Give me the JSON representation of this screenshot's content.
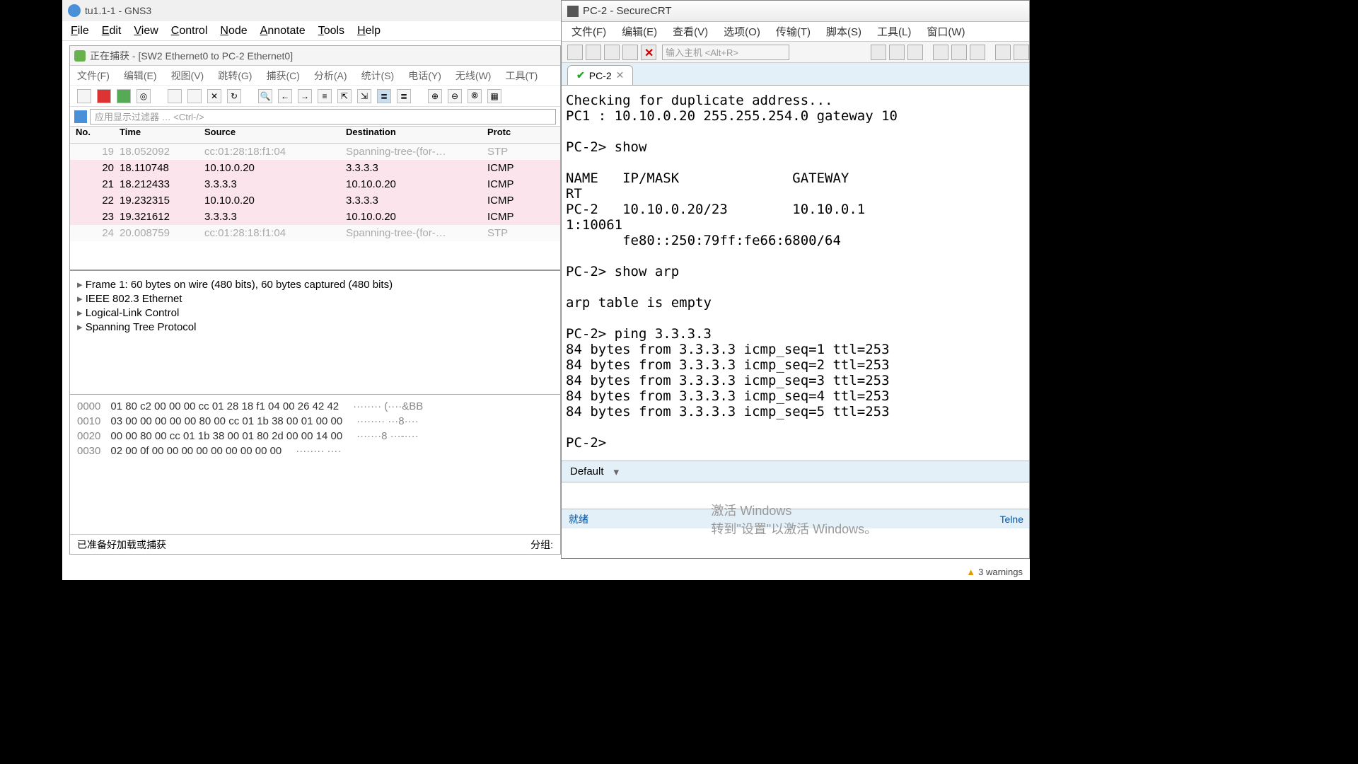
{
  "gns3": {
    "title": "tu1.1-1 - GNS3",
    "menu": [
      "File",
      "Edit",
      "View",
      "Control",
      "Node",
      "Annotate",
      "Tools",
      "Help"
    ]
  },
  "wireshark": {
    "title": "正在捕获 - [SW2 Ethernet0 to PC-2 Ethernet0]",
    "menu": [
      "文件(F)",
      "编辑(E)",
      "视图(V)",
      "跳转(G)",
      "捕获(C)",
      "分析(A)",
      "统计(S)",
      "电话(Y)",
      "无线(W)",
      "工具(T)"
    ],
    "filter_placeholder": "应用显示过滤器 … <Ctrl-/>",
    "columns": [
      "No.",
      "Time",
      "Source",
      "Destination",
      "Protc"
    ],
    "rows": [
      {
        "no": "19",
        "time": "18.052092",
        "src": "cc:01:28:18:f1:04",
        "dst": "Spanning-tree-(for-…",
        "proto": "STP",
        "grey": true
      },
      {
        "no": "20",
        "time": "18.110748",
        "src": "10.10.0.20",
        "dst": "3.3.3.3",
        "proto": "ICMP",
        "pink": true
      },
      {
        "no": "21",
        "time": "18.212433",
        "src": "3.3.3.3",
        "dst": "10.10.0.20",
        "proto": "ICMP",
        "pink": true
      },
      {
        "no": "22",
        "time": "19.232315",
        "src": "10.10.0.20",
        "dst": "3.3.3.3",
        "proto": "ICMP",
        "pink": true
      },
      {
        "no": "23",
        "time": "19.321612",
        "src": "3.3.3.3",
        "dst": "10.10.0.20",
        "proto": "ICMP",
        "pink": true
      },
      {
        "no": "24",
        "time": "20.008759",
        "src": "cc:01:28:18:f1:04",
        "dst": "Spanning-tree-(for-…",
        "proto": "STP",
        "grey": true
      }
    ],
    "details": [
      "Frame 1: 60 bytes on wire (480 bits), 60 bytes captured (480 bits)",
      "IEEE 802.3 Ethernet",
      "Logical-Link Control",
      "Spanning Tree Protocol"
    ],
    "hex": [
      {
        "off": "0000",
        "bytes": "01 80 c2 00 00 00 cc 01  28 18 f1 04 00 26 42 42",
        "ascii": "········ (····&BB"
      },
      {
        "off": "0010",
        "bytes": "03 00 00 00 00 00 80 00  cc 01 1b 38 00 01 00 00",
        "ascii": "········ ···8····"
      },
      {
        "off": "0020",
        "bytes": "00 00 80 00 cc 01 1b 38  00 01 80 2d 00 00 14 00",
        "ascii": "·······8 ···-····"
      },
      {
        "off": "0030",
        "bytes": "02 00 0f 00 00 00 00 00  00 00 00 00",
        "ascii": "········ ····"
      }
    ],
    "status_left": "已准备好加载或捕获",
    "status_right": "分组:"
  },
  "securecrt": {
    "title": "PC-2 - SecureCRT",
    "menu": [
      "文件(F)",
      "编辑(E)",
      "查看(V)",
      "选项(O)",
      "传输(T)",
      "脚本(S)",
      "工具(L)",
      "窗口(W)"
    ],
    "host_placeholder": "输入主机 <Alt+R>",
    "tab": "PC-2",
    "terminal": "Checking for duplicate address...\nPC1 : 10.10.0.20 255.255.254.0 gateway 10\n\nPC-2> show\n\nNAME   IP/MASK              GATEWAY\nRT\nPC-2   10.10.0.20/23        10.10.0.1\n1:10061\n       fe80::250:79ff:fe66:6800/64\n\nPC-2> show arp\n\narp table is empty\n\nPC-2> ping 3.3.3.3\n84 bytes from 3.3.3.3 icmp_seq=1 ttl=253\n84 bytes from 3.3.3.3 icmp_seq=2 ttl=253\n84 bytes from 3.3.3.3 icmp_seq=3 ttl=253\n84 bytes from 3.3.3.3 icmp_seq=4 ttl=253\n84 bytes from 3.3.3.3 icmp_seq=5 ttl=253\n\nPC-2>",
    "sheet": "Default",
    "status_left": "就绪",
    "status_right": "Telne"
  },
  "watermark": {
    "main": "激活 Windows",
    "sub": "转到\"设置\"以激活 Windows。"
  },
  "warnings": "3 warnings"
}
